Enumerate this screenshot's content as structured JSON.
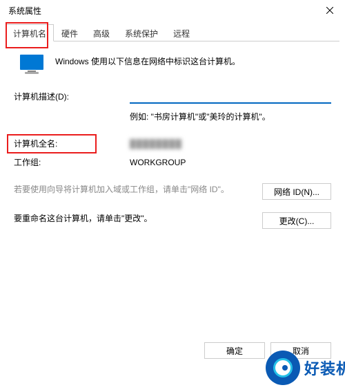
{
  "window": {
    "title": "系统属性"
  },
  "tabs": {
    "computer_name": "计算机名",
    "hardware": "硬件",
    "advanced": "高级",
    "system_protection": "系统保护",
    "remote": "远程"
  },
  "header": {
    "text": "Windows 使用以下信息在网络中标识这台计算机。"
  },
  "form": {
    "description_label": "计算机描述(D):",
    "description_value": "",
    "example_text": "例如: \"书房计算机\"或\"美玲的计算机\"。",
    "fullname_label": "计算机全名:",
    "fullname_value": "████████",
    "workgroup_label": "工作组:",
    "workgroup_value": "WORKGROUP"
  },
  "actions": {
    "network_id_text": "若要使用向导将计算机加入域或工作组，请单击\"网络 ID\"。",
    "network_id_button": "网络 ID(N)...",
    "rename_text": "要重命名这台计算机，请单击\"更改\"。",
    "rename_button": "更改(C)..."
  },
  "buttons": {
    "ok": "确定",
    "cancel": "取消"
  },
  "watermark": {
    "text": "好装机"
  },
  "icons": {
    "close": "close-icon",
    "monitor": "monitor-icon"
  },
  "colors": {
    "accent": "#0067c0",
    "highlight": "#ea1c1c",
    "watermark": "#0a5ab4"
  }
}
